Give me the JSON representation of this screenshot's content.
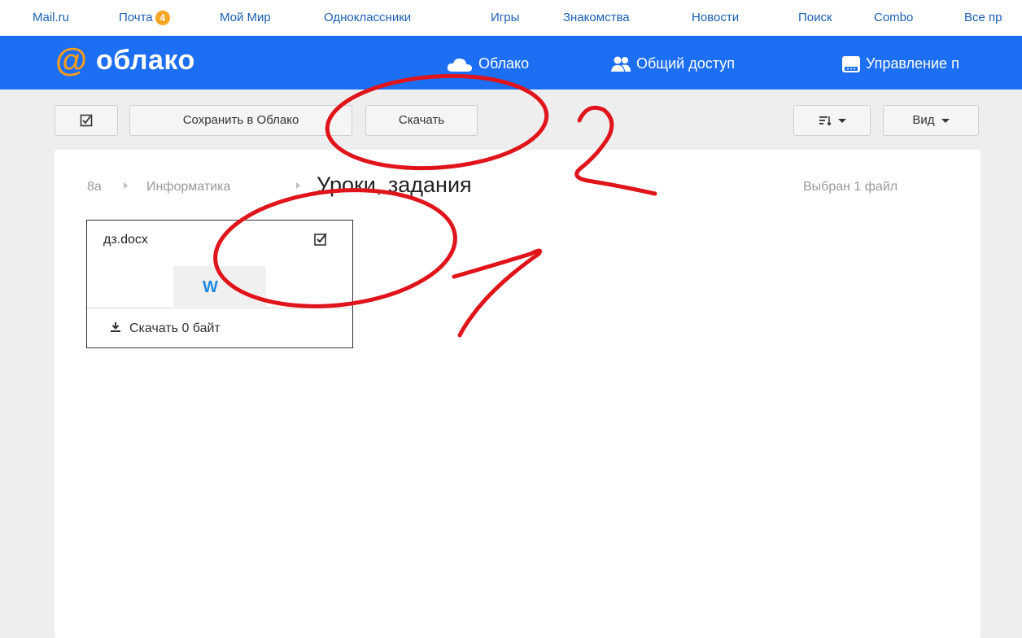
{
  "portal_nav": {
    "items": [
      {
        "label": "Mail.ru"
      },
      {
        "label": "Почта",
        "badge": "4"
      },
      {
        "label": "Мой Мир"
      },
      {
        "label": "Одноклассники"
      },
      {
        "label": "Игры"
      },
      {
        "label": "Знакомства"
      },
      {
        "label": "Новости"
      },
      {
        "label": "Поиск"
      },
      {
        "label": "Combo"
      },
      {
        "label": "Все пр"
      }
    ]
  },
  "header": {
    "logo_symbol": "@",
    "logo_text": "облако",
    "nav": [
      {
        "label": "Облако",
        "icon": "cloud-icon"
      },
      {
        "label": "Общий доступ",
        "icon": "users-icon"
      },
      {
        "label": "Управление п",
        "icon": "manage-icon"
      }
    ]
  },
  "toolbar": {
    "save_label": "Сохранить в Облако",
    "download_label": "Скачать",
    "view_label": "Вид",
    "sort_icon": "sort-icon",
    "select_icon": "checkbox-icon"
  },
  "breadcrumb": {
    "items": [
      "8а",
      "Информатика"
    ],
    "current": "Уроки, задания"
  },
  "selection_status": "Выбран 1 файл",
  "file": {
    "name": "дз.docx",
    "thumb_letter": "W",
    "download_label": "Скачать 0 байт",
    "checked": true
  },
  "annotations": {
    "color": "#e0141b",
    "labels": [
      "1",
      "2"
    ]
  },
  "colors": {
    "header_blue": "#1c6ef2",
    "link_blue": "#1a5fb4",
    "logo_orange": "#f89c1c",
    "badge_orange": "#f5a623",
    "word_blue": "#1e88e5"
  }
}
